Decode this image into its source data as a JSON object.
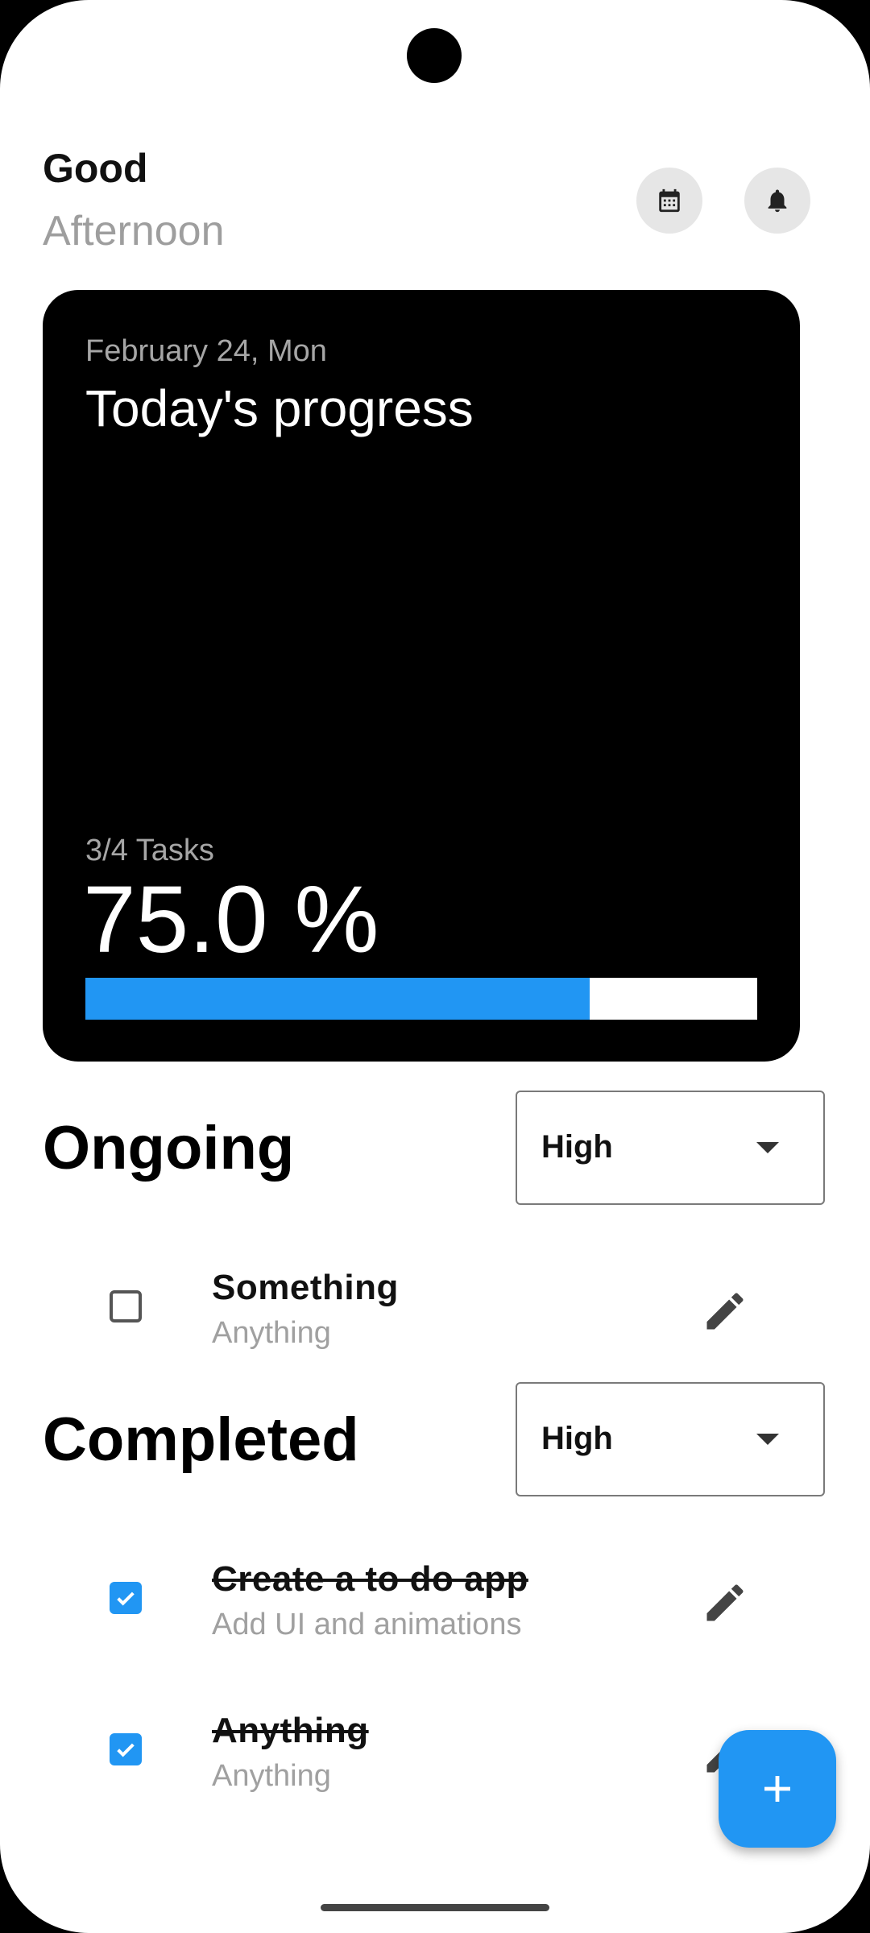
{
  "header": {
    "greeting_line1": "Good",
    "greeting_line2": "Afternoon"
  },
  "icons": {
    "calendar": "calendar-icon",
    "notifications": "bell-icon",
    "edit": "pencil-icon",
    "add": "plus-icon",
    "check": "check-icon"
  },
  "progress_card": {
    "date": "February 24, Mon",
    "title": "Today's progress",
    "tasks_text": "3/4 Tasks",
    "percent_text": "75.0 %",
    "progress_fraction": 0.75
  },
  "ongoing": {
    "title": "Ongoing",
    "filter_value": "High",
    "tasks": [
      {
        "title": "Something",
        "subtitle": "Anything",
        "completed": false
      }
    ]
  },
  "completed": {
    "title": "Completed",
    "filter_value": "High",
    "tasks": [
      {
        "title": "Create a to do app",
        "subtitle": "Add UI and animations",
        "completed": true
      },
      {
        "title": "Anything",
        "subtitle": "Anything",
        "completed": true
      }
    ]
  },
  "colors": {
    "accent": "#2196f3",
    "card_background": "#000000",
    "secondary_text": "#9e9e9e",
    "icon_button_bg": "#e6e6e6"
  }
}
